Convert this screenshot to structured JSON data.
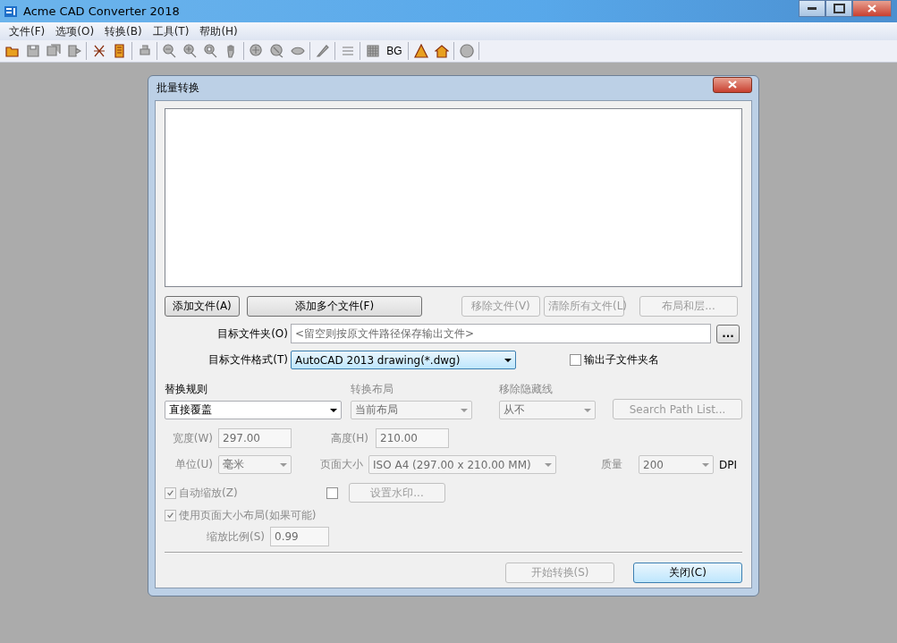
{
  "window": {
    "title": "Acme CAD Converter 2018"
  },
  "menu": [
    {
      "label": "文件(F)"
    },
    {
      "label": "选项(O)"
    },
    {
      "label": "转换(B)"
    },
    {
      "label": "工具(T)"
    },
    {
      "label": "帮助(H)"
    }
  ],
  "toolbar": [
    {
      "kind": "icon",
      "disabled": false
    },
    {
      "kind": "icon",
      "disabled": true
    },
    {
      "kind": "icon",
      "disabled": true
    },
    {
      "kind": "icon",
      "disabled": true
    },
    {
      "kind": "sep"
    },
    {
      "kind": "icon",
      "disabled": false
    },
    {
      "kind": "icon",
      "disabled": false
    },
    {
      "kind": "sep"
    },
    {
      "kind": "icon",
      "disabled": true
    },
    {
      "kind": "sep"
    },
    {
      "kind": "icon",
      "disabled": true
    },
    {
      "kind": "icon",
      "disabled": true
    },
    {
      "kind": "icon",
      "disabled": true
    },
    {
      "kind": "icon",
      "disabled": true
    },
    {
      "kind": "sep"
    },
    {
      "kind": "icon",
      "disabled": true
    },
    {
      "kind": "icon",
      "disabled": true
    },
    {
      "kind": "icon",
      "disabled": true
    },
    {
      "kind": "sep"
    },
    {
      "kind": "icon",
      "disabled": true
    },
    {
      "kind": "sep"
    },
    {
      "kind": "icon",
      "disabled": true
    },
    {
      "kind": "sep"
    },
    {
      "kind": "icon",
      "disabled": true
    },
    {
      "kind": "text",
      "label": "BG",
      "disabled": false
    },
    {
      "kind": "sep"
    },
    {
      "kind": "icon",
      "disabled": false
    },
    {
      "kind": "icon",
      "disabled": false
    },
    {
      "kind": "sep"
    },
    {
      "kind": "icon",
      "disabled": true
    },
    {
      "kind": "sep"
    }
  ],
  "dialog": {
    "title": "批量转换",
    "file_buttons": [
      {
        "label": "添加文件(A)",
        "disabled": false
      },
      {
        "label": "添加多个文件(F)",
        "disabled": false
      },
      {
        "label": "移除文件(V)",
        "disabled": true
      },
      {
        "label": "清除所有文件(L)",
        "disabled": true
      },
      {
        "label": "布局和层...",
        "disabled": true
      }
    ],
    "target_folder": {
      "label": "目标文件夹(O)",
      "placeholder": "<留空则按原文件路径保存输出文件>",
      "browse": "..."
    },
    "target_format": {
      "label": "目标文件格式(T)",
      "value": "AutoCAD 2013 drawing(*.dwg)"
    },
    "subfolder": {
      "label": "输出子文件夹名",
      "checked": false
    },
    "replace_rule": {
      "label": "替换规则",
      "value": "直接覆盖",
      "disabled": false
    },
    "convert_layout": {
      "label": "转换布局",
      "value": "当前布局",
      "disabled": true
    },
    "hidden_lines": {
      "label": "移除隐藏线",
      "value": "从不",
      "disabled": true
    },
    "search_path": {
      "label": "Search Path List...",
      "disabled": true
    },
    "width": {
      "label": "宽度(W)",
      "value": "297.00"
    },
    "height": {
      "label": "高度(H)",
      "value": "210.00"
    },
    "unit": {
      "label": "单位(U)",
      "value": "毫米"
    },
    "page_size": {
      "label": "页面大小",
      "value": "ISO A4 (297.00 x 210.00 MM)"
    },
    "quality": {
      "label": "质量",
      "value": "200",
      "unit": "DPI"
    },
    "auto_zoom": {
      "label": "自动缩放(Z)",
      "checked": true,
      "disabled": true
    },
    "watermark": {
      "checked": false,
      "button": "设置水印..."
    },
    "page_layout": {
      "label": "使用页面大小布局(如果可能)",
      "checked": true,
      "disabled": true
    },
    "scale": {
      "label": "缩放比例(S)",
      "value": "0.99"
    },
    "actions": [
      {
        "label": "开始转换(S)",
        "disabled": true,
        "default": false
      },
      {
        "label": "关闭(C)",
        "disabled": false,
        "default": true
      }
    ]
  }
}
